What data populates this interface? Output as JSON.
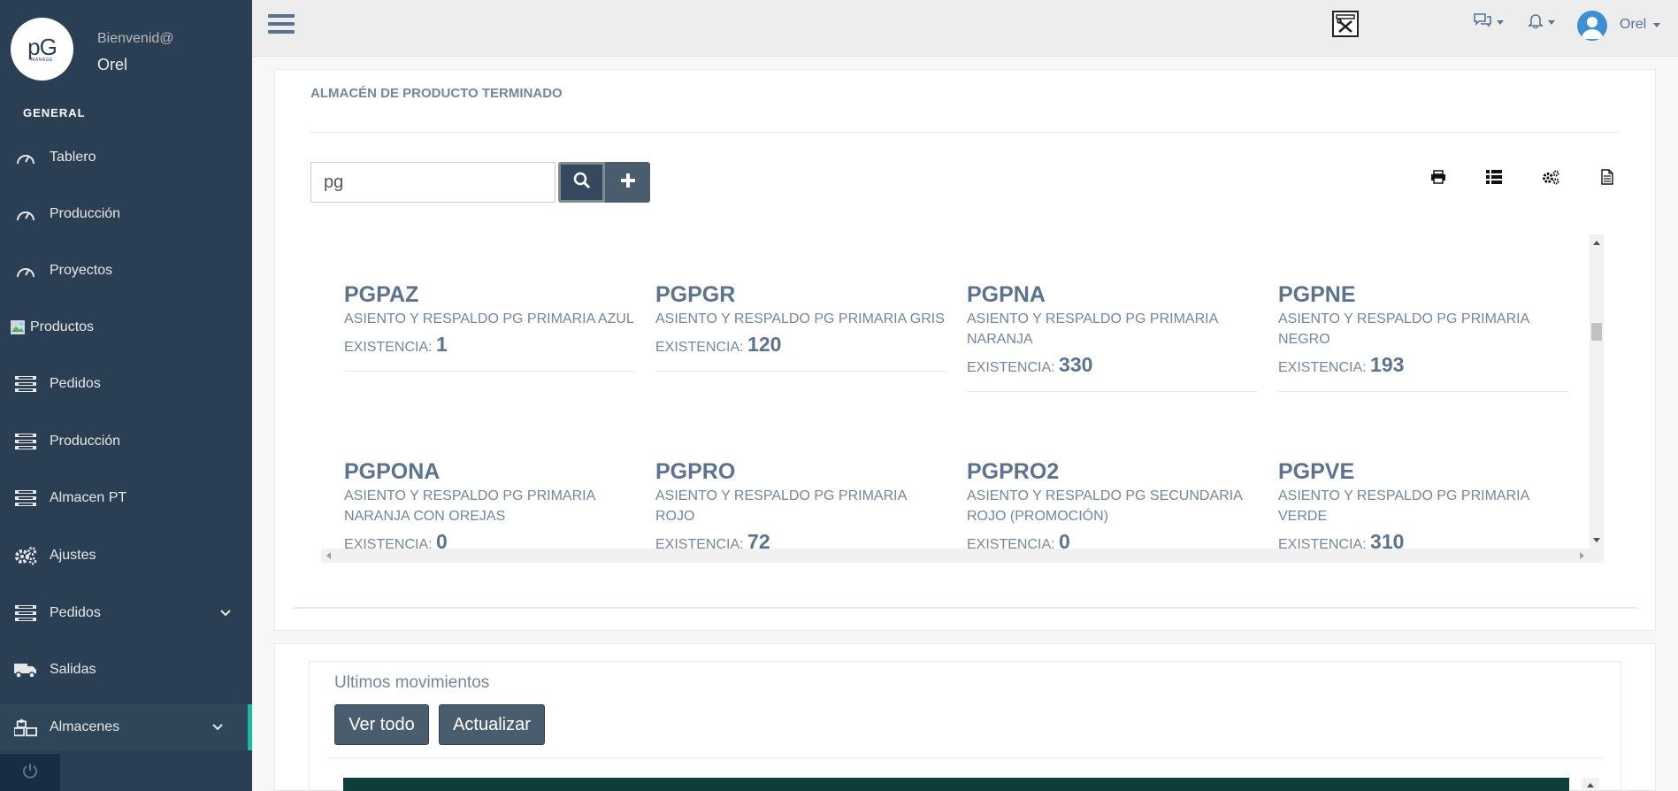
{
  "sidebar": {
    "logo": {
      "main": "pG",
      "sub": "MANAGE"
    },
    "welcome": "Bienvenid@",
    "user": "Orel",
    "section": "GENERAL",
    "items": [
      {
        "label": "Tablero",
        "icon": "dashboard-icon"
      },
      {
        "label": "Producción",
        "icon": "dashboard-icon"
      },
      {
        "label": "Proyectos",
        "icon": "dashboard-icon"
      },
      {
        "label": "Productos",
        "icon": "broken-image-icon"
      },
      {
        "label": "Pedidos",
        "icon": "list-icon"
      },
      {
        "label": "Producción",
        "icon": "list-icon"
      },
      {
        "label": "Almacen PT",
        "icon": "list-icon"
      },
      {
        "label": "Ajustes",
        "icon": "gears-icon"
      },
      {
        "label": "Pedidos",
        "icon": "list-icon"
      },
      {
        "label": "Salidas",
        "icon": "truck-icon"
      },
      {
        "label": "Almacenes",
        "icon": "cubes-icon"
      }
    ]
  },
  "topnav": {
    "user": "Orel"
  },
  "panel": {
    "title": "ALMACÉN DE PRODUCTO TERMINADO",
    "search_value": "pg",
    "stock_label": "EXISTENCIA:",
    "products": [
      {
        "code": "PGPAZ",
        "desc": "ASIENTO Y RESPALDO PG PRIMARIA AZUL",
        "stock": "1"
      },
      {
        "code": "PGPGR",
        "desc": "ASIENTO Y RESPALDO PG PRIMARIA GRIS",
        "stock": "120"
      },
      {
        "code": "PGPNA",
        "desc": "ASIENTO Y RESPALDO PG PRIMARIA NARANJA",
        "stock": "330"
      },
      {
        "code": "PGPNE",
        "desc": "ASIENTO Y RESPALDO PG PRIMARIA NEGRO",
        "stock": "193"
      },
      {
        "code": "PGPONA",
        "desc": "ASIENTO Y RESPALDO PG PRIMARIA NARANJA CON OREJAS",
        "stock": "0"
      },
      {
        "code": "PGPRO",
        "desc": "ASIENTO Y RESPALDO PG PRIMARIA ROJO",
        "stock": "72"
      },
      {
        "code": "PGPRO2",
        "desc": "ASIENTO Y RESPALDO PG SECUNDARIA ROJO (PROMOCIÓN)",
        "stock": "0"
      },
      {
        "code": "PGPVE",
        "desc": "ASIENTO Y RESPALDO PG PRIMARIA VERDE",
        "stock": "310"
      }
    ]
  },
  "movements": {
    "title": "Ultimos movimientos",
    "view_all": "Ver todo",
    "refresh": "Actualizar"
  },
  "colors": {
    "sidebar_bg": "#2a3f54",
    "accent": "#1abb9c",
    "button_dark": "#4a5d6e",
    "table_header": "#0d3e3c"
  }
}
